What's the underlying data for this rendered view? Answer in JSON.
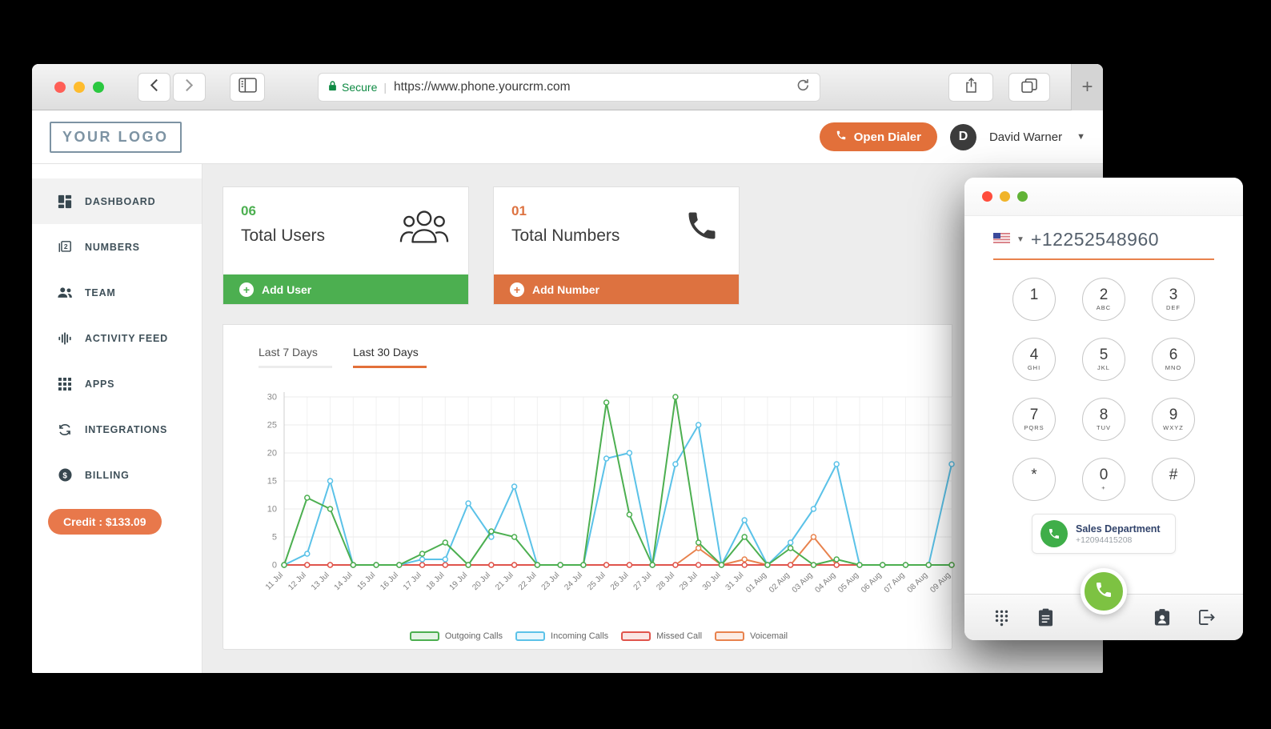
{
  "browser": {
    "secure_label": "Secure",
    "url": "https://www.phone.yourcrm.com",
    "new_tab_label": "+"
  },
  "header": {
    "logo_text": "YOUR LOGO",
    "open_dialer_label": "Open Dialer",
    "user_initial": "D",
    "user_name": "David Warner"
  },
  "sidebar": {
    "items": [
      {
        "label": "DASHBOARD",
        "icon": "dashboard-icon",
        "active": true
      },
      {
        "label": "NUMBERS",
        "icon": "numbers-icon",
        "active": false
      },
      {
        "label": "TEAM",
        "icon": "team-icon",
        "active": false
      },
      {
        "label": "ACTIVITY FEED",
        "icon": "activity-feed-icon",
        "active": false
      },
      {
        "label": "APPS",
        "icon": "apps-icon",
        "active": false
      },
      {
        "label": "INTEGRATIONS",
        "icon": "integrations-icon",
        "active": false
      },
      {
        "label": "BILLING",
        "icon": "billing-icon",
        "active": false
      }
    ],
    "credit_label": "Credit : $133.09",
    "credit_color": "#e8784b"
  },
  "stats_cards": [
    {
      "count": "06",
      "label": "Total Users",
      "action_label": "Add User",
      "accent": "#4caf50",
      "icon": "users-group-icon"
    },
    {
      "count": "01",
      "label": "Total Numbers",
      "action_label": "Add Number",
      "accent": "#dd7240",
      "icon": "phone-icon"
    }
  ],
  "chart_panel": {
    "tabs": [
      {
        "label": "Last 7 Days",
        "active": false
      },
      {
        "label": "Last 30 Days",
        "active": true
      }
    ],
    "active_tab_color": "#e2703a"
  },
  "chart_data": {
    "type": "line",
    "x": [
      "11 Jul",
      "12 Jul",
      "13 Jul",
      "14 Jul",
      "15 Jul",
      "16 Jul",
      "17 Jul",
      "18 Jul",
      "19 Jul",
      "20 Jul",
      "21 Jul",
      "22 Jul",
      "23 Jul",
      "24 Jul",
      "25 Jul",
      "26 Jul",
      "27 Jul",
      "28 Jul",
      "29 Jul",
      "30 Jul",
      "31 Jul",
      "01 Aug",
      "02 Aug",
      "03 Aug",
      "04 Aug",
      "05 Aug",
      "06 Aug",
      "07 Aug",
      "08 Aug",
      "09 Aug"
    ],
    "series": [
      {
        "name": "Outgoing Calls",
        "color": "#4caf50",
        "values": [
          0,
          12,
          10,
          0,
          0,
          0,
          2,
          4,
          0,
          6,
          5,
          0,
          0,
          0,
          29,
          9,
          0,
          30,
          4,
          0,
          5,
          0,
          3,
          0,
          1,
          0,
          0,
          0,
          0,
          0
        ]
      },
      {
        "name": "Incoming Calls",
        "color": "#5bc2e8",
        "values": [
          0,
          2,
          15,
          0,
          0,
          0,
          1,
          1,
          11,
          5,
          14,
          0,
          0,
          0,
          19,
          20,
          0,
          18,
          25,
          0,
          8,
          0,
          4,
          10,
          18,
          0,
          0,
          0,
          0,
          18
        ]
      },
      {
        "name": "Missed Call",
        "color": "#e0544c",
        "values": [
          0,
          0,
          0,
          0,
          0,
          0,
          0,
          0,
          0,
          0,
          0,
          0,
          0,
          0,
          0,
          0,
          0,
          0,
          0,
          0,
          0,
          0,
          0,
          0,
          0,
          0,
          0,
          0,
          0,
          0
        ]
      },
      {
        "name": "Voicemail",
        "color": "#e8824d",
        "values": [
          0,
          0,
          0,
          0,
          0,
          0,
          0,
          0,
          0,
          0,
          0,
          0,
          0,
          0,
          0,
          0,
          0,
          0,
          3,
          0,
          1,
          0,
          0,
          5,
          0,
          0,
          0,
          0,
          0,
          0
        ]
      }
    ],
    "ylim": [
      0,
      30
    ],
    "yticks": [
      0,
      5,
      10,
      15,
      20,
      25,
      30
    ],
    "grid": true,
    "legend_position": "bottom"
  },
  "dialer": {
    "flag_icon": "us-flag-icon",
    "number": "+12252548960",
    "keys": [
      {
        "digit": "1",
        "letters": ""
      },
      {
        "digit": "2",
        "letters": "ABC"
      },
      {
        "digit": "3",
        "letters": "DEF"
      },
      {
        "digit": "4",
        "letters": "GHI"
      },
      {
        "digit": "5",
        "letters": "JKL"
      },
      {
        "digit": "6",
        "letters": "MNO"
      },
      {
        "digit": "7",
        "letters": "PQRS"
      },
      {
        "digit": "8",
        "letters": "TUV"
      },
      {
        "digit": "9",
        "letters": "WXYZ"
      },
      {
        "digit": "*",
        "letters": ""
      },
      {
        "digit": "0",
        "letters": "+"
      },
      {
        "digit": "#",
        "letters": ""
      }
    ],
    "favorite": {
      "name": "Sales Department",
      "number": "+12094415208"
    },
    "call_button_color": "#7dc242",
    "bottom_icons": [
      "dialpad-icon",
      "notes-icon",
      "contacts-icon",
      "exit-icon"
    ]
  }
}
